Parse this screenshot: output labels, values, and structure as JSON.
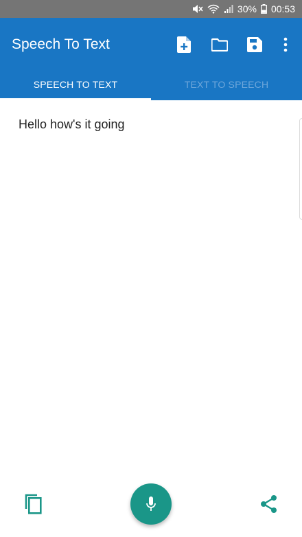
{
  "status_bar": {
    "battery_percent": "30%",
    "time": "00:53",
    "icons": [
      "mute-icon",
      "wifi-icon",
      "signal-icon",
      "battery-icon"
    ]
  },
  "app_bar": {
    "title": "Speech To Text",
    "actions": [
      "new-file-icon",
      "folder-icon",
      "save-icon",
      "more-vert-icon"
    ]
  },
  "tabs": [
    {
      "label": "SPEECH TO TEXT",
      "active": true
    },
    {
      "label": "TEXT TO SPEECH",
      "active": false
    }
  ],
  "content": {
    "transcript": "Hello how's it going"
  },
  "bottom_bar": {
    "left": "copy-icon",
    "center": "mic-icon",
    "right": "share-icon"
  },
  "colors": {
    "primary": "#1976c4",
    "accent": "#1a9688",
    "status_bar": "#757575",
    "inactive_tab": "#6fa7da"
  }
}
